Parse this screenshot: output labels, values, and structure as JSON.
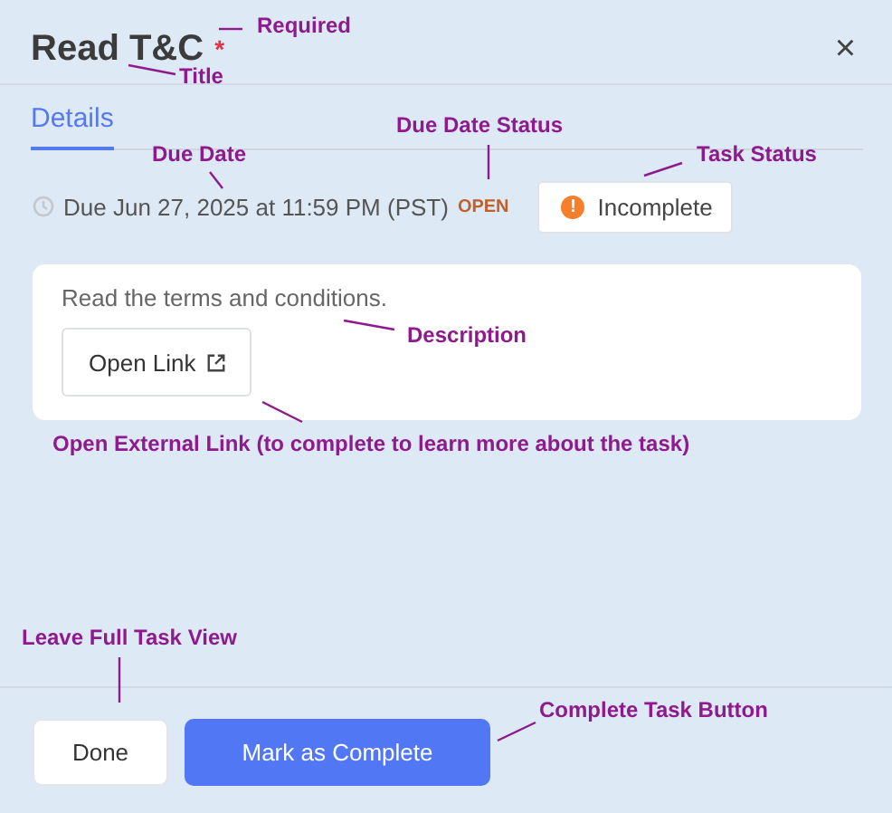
{
  "header": {
    "title": "Read T&C",
    "required_mark": "*",
    "close": "×"
  },
  "tabs": [
    {
      "label": "Details",
      "selected": true
    }
  ],
  "due": {
    "text": "Due Jun 27, 2025 at 11:59 PM (PST)",
    "status": "OPEN"
  },
  "task_status": {
    "label": "Incomplete",
    "icon": "!"
  },
  "card": {
    "description": "Read the terms and conditions.",
    "link_button": "Open Link"
  },
  "footer": {
    "buttons": [
      {
        "label": "Done",
        "kind": "secondary"
      },
      {
        "label": "Mark as Complete",
        "kind": "primary"
      }
    ]
  },
  "annotations": [
    {
      "text": "Required"
    },
    {
      "text": "Title"
    },
    {
      "text": "Due Date"
    },
    {
      "text": "Due Date Status"
    },
    {
      "text": "Task Status"
    },
    {
      "text": "Description"
    },
    {
      "text": "Open External Link (to complete to learn more about the task)"
    },
    {
      "text": "Leave Full Task View"
    },
    {
      "text": "Complete Task Button"
    }
  ]
}
